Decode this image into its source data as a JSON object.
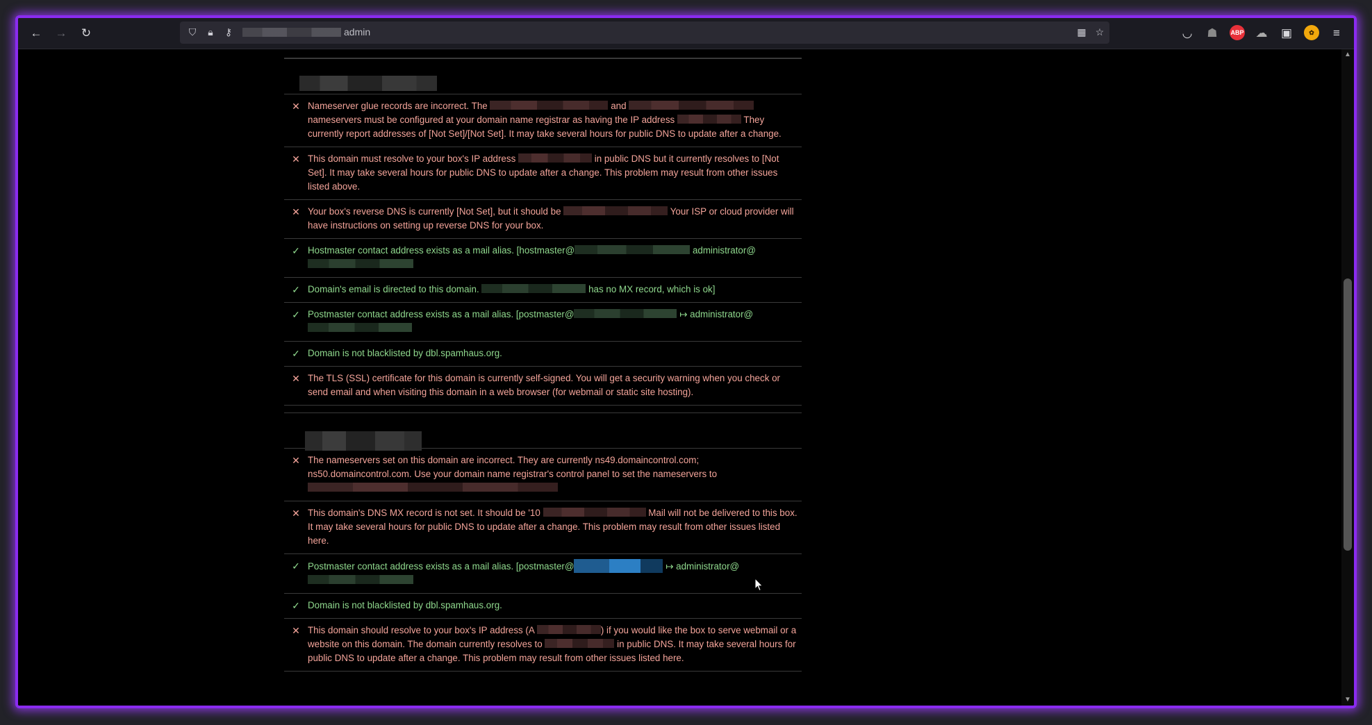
{
  "browser": {
    "url_suffix": "admin",
    "icons": {
      "back": "arrow-left-icon",
      "forward": "arrow-right-icon",
      "reload": "reload-icon",
      "shield": "shield-icon",
      "lock": "lock-icon",
      "key": "key-icon",
      "qr": "qr-code-icon",
      "bookmark": "star-icon",
      "pocket": "pocket-icon",
      "extensions": "puzzle-icon",
      "menu": "hamburger-menu-icon"
    },
    "extensions": [
      {
        "name": "abp-icon",
        "label": "ABP",
        "color": "#e8313a"
      },
      {
        "name": "ublock-icon",
        "label": "",
        "color": "#888888"
      },
      {
        "name": "fox-icon",
        "label": "",
        "color": "#f2a80c"
      }
    ]
  },
  "sections": [
    {
      "type": "rows",
      "rows": [
        {
          "status": "error",
          "parts": [
            "Nameserver glue records are incorrect. The ",
            "#r:170",
            " and ",
            "#r:180",
            " nameservers must be configured at your domain name registrar as having the IP address ",
            "#r:92",
            " They currently report addresses of [Not Set]/[Not Set]. It may take several hours for public DNS to update after a change."
          ]
        },
        {
          "status": "error",
          "parts": [
            "This domain must resolve to your box's IP address ",
            "#r:106",
            " in public DNS but it currently resolves to [Not Set]. It may take several hours for public DNS to update after a change. This problem may result from other issues listed above."
          ]
        },
        {
          "status": "error",
          "parts": [
            "Your box's reverse DNS is currently [Not Set], but it should be ",
            "#r:150",
            " Your ISP or cloud provider will have instructions on setting up reverse DNS for your box."
          ]
        },
        {
          "status": "ok",
          "parts": [
            "Hostmaster contact address exists as a mail alias. [hostmaster@",
            "#r:166",
            " administrator@",
            "#r:152"
          ]
        },
        {
          "status": "ok",
          "parts": [
            "Domain's email is directed to this domain. ",
            "#r:150",
            " has no MX record, which is ok]"
          ]
        },
        {
          "status": "ok",
          "parts": [
            "Postmaster contact address exists as a mail alias. [postmaster@",
            "#r:148",
            " ↦ administrator@",
            "#r:150"
          ]
        },
        {
          "status": "ok",
          "parts": [
            "Domain is not blacklisted by dbl.spamhaus.org."
          ]
        },
        {
          "status": "error",
          "parts": [
            "The TLS (SSL) certificate for this domain is currently self-signed. You will get a security warning when you check or send email and when visiting this domain in a web browser (for webmail or static site hosting)."
          ]
        }
      ]
    },
    {
      "type": "rows",
      "rows": [
        {
          "status": "error",
          "parts": [
            "The nameservers set on this domain are incorrect. They are currently ns49.domaincontrol.com; ns50.domaincontrol.com. Use your domain name registrar's control panel to set the nameservers to ",
            "#r:360"
          ]
        },
        {
          "status": "error",
          "parts": [
            "This domain's DNS MX record is not set. It should be '10 ",
            "#r:148",
            " Mail will not be delivered to this box. It may take several hours for public DNS to update after a change. This problem may result from other issues listed here."
          ]
        },
        {
          "status": "ok",
          "parts": [
            "Postmaster contact address exists as a mail alias. [postmaster@",
            "#b:128",
            " ↦ administrator@",
            "#r:152"
          ]
        },
        {
          "status": "ok",
          "parts": [
            "Domain is not blacklisted by dbl.spamhaus.org."
          ]
        },
        {
          "status": "error",
          "parts": [
            "This domain should resolve to your box's IP address (A ",
            "#r:92",
            ") if you would like the box to serve webmail or a website on this domain. The domain currently resolves to ",
            "#r:100",
            " in public DNS. It may take several hours for public DNS to update after a change. This problem may result from other issues listed here."
          ]
        }
      ]
    }
  ],
  "status_marks": {
    "error": "✕",
    "ok": "✓"
  }
}
